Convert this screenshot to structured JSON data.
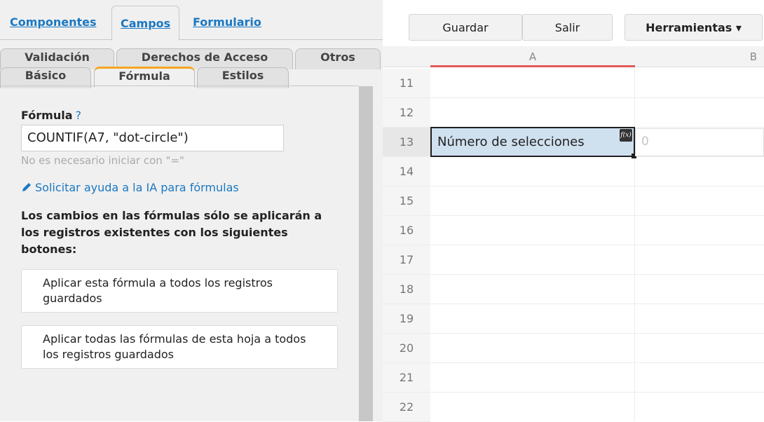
{
  "top_tabs": [
    {
      "label": "Componentes"
    },
    {
      "label": "Campos"
    },
    {
      "label": "Formulario"
    }
  ],
  "sub_tabs_row1": [
    {
      "label": "Validación"
    },
    {
      "label": "Derechos de Acceso"
    },
    {
      "label": "Otros"
    }
  ],
  "sub_tabs_row2": [
    {
      "label": "Básico"
    },
    {
      "label": "Fórmula"
    },
    {
      "label": "Estilos"
    }
  ],
  "formula": {
    "label": "Fórmula",
    "help": "?",
    "value": "COUNTIF(A7, \"dot-circle\")",
    "hint": "No es necesario iniciar con \"=\"",
    "ai_link": "Solicitar ayuda a la IA para fórmulas",
    "note": "Los cambios en las fórmulas sólo se aplicarán a los registros existentes con los siguientes botones:",
    "apply_one": "Aplicar esta fórmula a todos los registros guardados",
    "apply_all": "Aplicar todas las fórmulas de esta hoja a todos los registros guardados"
  },
  "toolbar": {
    "save": "Guardar",
    "exit": "Salir",
    "tools": "Herramientas ▾"
  },
  "sheet": {
    "columns": [
      "A",
      "B"
    ],
    "rows": [
      "11",
      "12",
      "13",
      "14",
      "15",
      "16",
      "17",
      "18",
      "19",
      "20",
      "21",
      "22"
    ],
    "selected_row": "13",
    "cell_a13": "Número de selecciones",
    "cell_b13": "0",
    "fx_badge": "f(x)"
  },
  "colors": {
    "link": "#1a78c2",
    "active_tab_accent": "#f5a623",
    "selected_cell": "#cfe0ef",
    "column_marker": "#e05a5a"
  }
}
